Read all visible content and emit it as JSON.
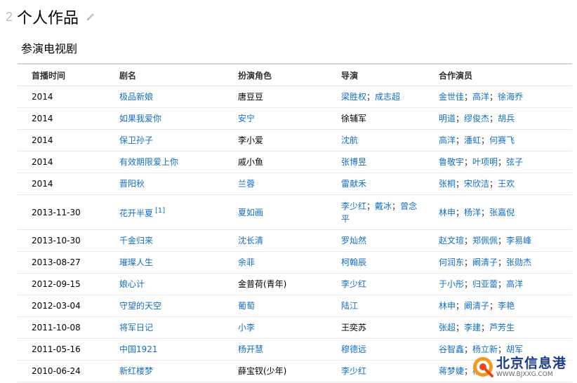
{
  "section": {
    "number": "2",
    "title": "个人作品"
  },
  "subsection": {
    "title": "参演电视剧"
  },
  "table": {
    "headers": [
      "首播时间",
      "剧名",
      "扮演角色",
      "导演",
      "合作演员"
    ],
    "rows": [
      {
        "date": "2014",
        "title": "极品新娘",
        "title_link": true,
        "role": "唐豆豆",
        "role_link": false,
        "director": [
          "梁胜权",
          "成志超"
        ],
        "director_link": true,
        "costars": [
          "金世佳",
          "高洋",
          "徐海乔"
        ]
      },
      {
        "date": "2014",
        "title": "如果我爱你",
        "title_link": true,
        "role": "安宁",
        "role_link": true,
        "director": [
          "徐辅军"
        ],
        "director_link": false,
        "costars": [
          "明道",
          "缪俊杰",
          "胡兵"
        ]
      },
      {
        "date": "2014",
        "title": "保卫孙子",
        "title_link": true,
        "role": "李小爱",
        "role_link": false,
        "director": [
          "沈航"
        ],
        "director_link": true,
        "costars": [
          "高洋",
          "潘虹",
          "何赛飞"
        ]
      },
      {
        "date": "2014",
        "title": "有效期限爱上你",
        "title_link": true,
        "role": "戚小鱼",
        "role_link": false,
        "director": [
          "张博昱"
        ],
        "director_link": true,
        "costars": [
          "鲁敬宇",
          "叶项明",
          "弦子"
        ]
      },
      {
        "date": "2014",
        "title": "晋阳秋",
        "title_link": true,
        "role": "兰蓉",
        "role_link": true,
        "director": [
          "雷献禾"
        ],
        "director_link": true,
        "costars": [
          "张桐",
          "宋欣洁",
          "王欢"
        ]
      },
      {
        "date": "2013-11-30",
        "title": "花开半夏",
        "title_link": true,
        "title_ref": "[1]",
        "role": "夏如画",
        "role_link": true,
        "director": [
          "李少红",
          "戴冰",
          "曾念平"
        ],
        "director_link": true,
        "costars": [
          "林申",
          "杨洋",
          "张嘉倪"
        ],
        "tall": true
      },
      {
        "date": "2013-10-30",
        "title": "千金归来",
        "title_link": true,
        "role": "沈长清",
        "role_link": true,
        "director": [
          "罗灿然"
        ],
        "director_link": true,
        "costars": [
          "赵文瑄",
          "郑佩佩",
          "李易峰"
        ]
      },
      {
        "date": "2013-08-27",
        "title": "璀璨人生",
        "title_link": true,
        "role": "余菲",
        "role_link": true,
        "director": [
          "柯翰辰"
        ],
        "director_link": true,
        "costars": [
          "何润东",
          "阚清子",
          "张勋杰"
        ]
      },
      {
        "date": "2012-09-15",
        "title": "娘心计",
        "title_link": true,
        "role": "金普荷(青年)",
        "role_link": false,
        "director": [
          "李少红"
        ],
        "director_link": true,
        "costars": [
          "于小彤",
          "归亚蕾",
          "高洋"
        ]
      },
      {
        "date": "2012-03-04",
        "title": "守望的天空",
        "title_link": true,
        "role": "葡萄",
        "role_link": true,
        "director": [
          "陆江"
        ],
        "director_link": true,
        "costars": [
          "林申",
          "阚清子",
          "李艳"
        ]
      },
      {
        "date": "2011-10-08",
        "title": "将军日记",
        "title_link": true,
        "role": "小李",
        "role_link": true,
        "director": [
          "王奕苏"
        ],
        "director_link": false,
        "costars": [
          "张超",
          "李建",
          "芦芳生"
        ]
      },
      {
        "date": "2011-05-16",
        "title": "中国1921",
        "title_link": true,
        "role": "杨开慧",
        "role_link": true,
        "director": [
          "穆德远"
        ],
        "director_link": true,
        "costars": [
          "谷智鑫",
          "杨立新",
          "胡军"
        ]
      },
      {
        "date": "2010-06-24",
        "title": "新红楼梦",
        "title_link": true,
        "role": "薛宝钗(少年)",
        "role_link": false,
        "director": [
          "李少红"
        ],
        "director_link": true,
        "costars": [
          "蒋梦婕",
          "杨洋"
        ]
      }
    ]
  },
  "watermark": {
    "name": "北京信息港",
    "url": "WWW.BJXXG.COM"
  },
  "colors": {
    "link": "#136ec2",
    "text": "#333333",
    "border": "#e8e8e8"
  }
}
